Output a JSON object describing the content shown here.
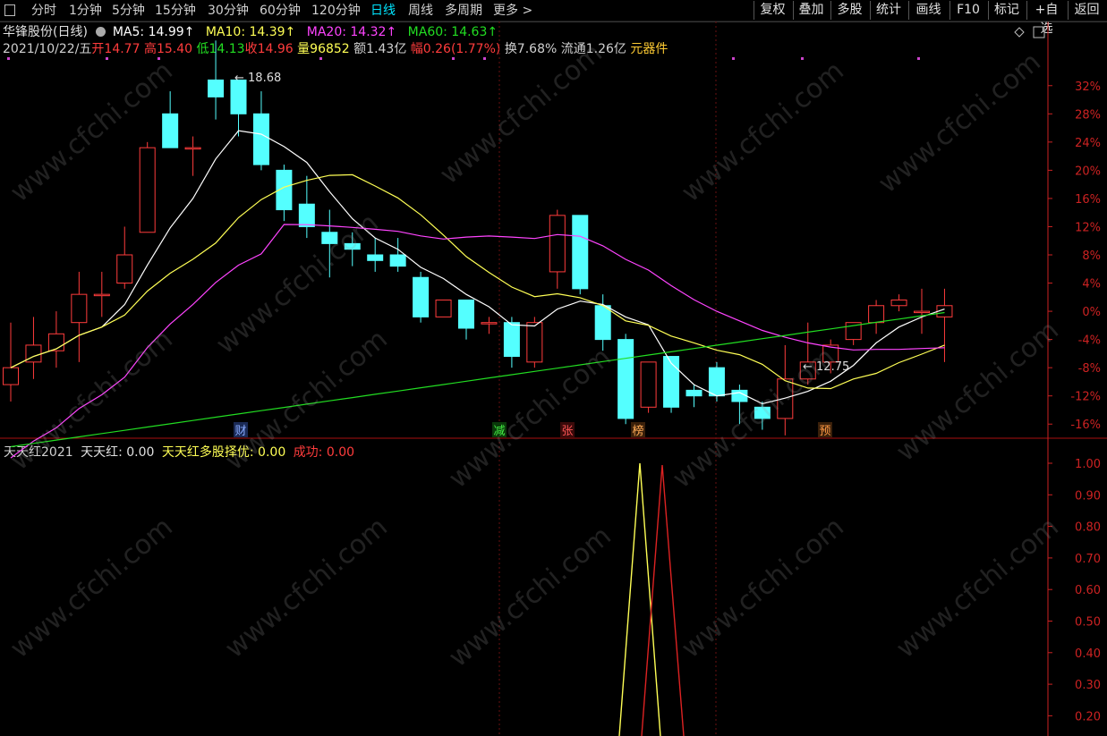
{
  "toolbar": {
    "periods": [
      "分时",
      "1分钟",
      "5分钟",
      "15分钟",
      "30分钟",
      "60分钟",
      "120分钟",
      "日线",
      "周线",
      "多周期",
      "更多 >"
    ],
    "active": "日线",
    "right_buttons": [
      "复权",
      "叠加",
      "多股",
      "统计",
      "画线",
      "F10",
      "标记",
      "+自选",
      "返回"
    ]
  },
  "stock": {
    "name": "华锋股份",
    "period": "(日线)",
    "ma5": "MA5: 14.99↑",
    "ma10": "MA10: 14.39↑",
    "ma20": "MA20: 14.32↑",
    "ma60": "MA60: 14.63↑",
    "date": "2021/10/22/五",
    "open": "开14.77",
    "high": "高15.40",
    "low": "低14.13",
    "close": "收14.96",
    "volume": "量96852",
    "amount": "额1.43亿",
    "change": "幅0.26(1.77%)",
    "turnover": "换7.68%",
    "float": "流通1.26亿",
    "sector": "元器件"
  },
  "indicator": {
    "name": "天天红2021",
    "v1": "天天红: 0.00",
    "v2": "天天红多股择优: 0.00",
    "v3": "成功: 0.00"
  },
  "colors": {
    "up": "#ff3c3c",
    "down": "#54ffff",
    "ma5": "#ffffff",
    "ma10": "#ffff55",
    "ma20": "#ff44ff",
    "ma60": "#22dd22",
    "axis": "#cc2222"
  },
  "watermark": "www.cfchi.com",
  "chart_data": {
    "type": "candlestick",
    "price_axis": {
      "labels": [
        "32%",
        "28%",
        "24%",
        "20%",
        "16%",
        "12%",
        "8%",
        "4%",
        "0%",
        "-4%",
        "-8%",
        "-12%",
        "-16%"
      ]
    },
    "candles": [
      {
        "o": 11.2,
        "c": 11.5,
        "h": 12.3,
        "l": 10.9
      },
      {
        "o": 11.6,
        "c": 11.9,
        "h": 12.4,
        "l": 11.3
      },
      {
        "o": 11.8,
        "c": 12.1,
        "h": 12.5,
        "l": 11.5
      },
      {
        "o": 12.3,
        "c": 12.8,
        "h": 13.2,
        "l": 11.6
      },
      {
        "o": 12.8,
        "c": 12.8,
        "h": 13.2,
        "l": 12.4
      },
      {
        "o": 13.0,
        "c": 13.5,
        "h": 14.0,
        "l": 12.9
      },
      {
        "o": 13.9,
        "c": 15.4,
        "h": 15.5,
        "l": 13.9
      },
      {
        "o": 16.0,
        "c": 15.4,
        "h": 16.4,
        "l": 15.4
      },
      {
        "o": 15.4,
        "c": 15.4,
        "h": 15.6,
        "l": 14.9
      },
      {
        "o": 16.6,
        "c": 16.3,
        "h": 17.3,
        "l": 15.9
      },
      {
        "o": 16.6,
        "c": 16.0,
        "h": 16.6,
        "l": 15.6
      },
      {
        "o": 16.0,
        "c": 15.1,
        "h": 16.4,
        "l": 15.0
      },
      {
        "o": 15.0,
        "c": 14.3,
        "h": 15.1,
        "l": 14.1
      },
      {
        "o": 14.4,
        "c": 14.0,
        "h": 14.9,
        "l": 13.8
      },
      {
        "o": 13.9,
        "c": 13.7,
        "h": 14.3,
        "l": 13.1
      },
      {
        "o": 13.7,
        "c": 13.6,
        "h": 13.9,
        "l": 13.3
      },
      {
        "o": 13.5,
        "c": 13.4,
        "h": 13.8,
        "l": 13.2
      },
      {
        "o": 13.5,
        "c": 13.3,
        "h": 13.8,
        "l": 13.2
      },
      {
        "o": 13.1,
        "c": 12.4,
        "h": 13.2,
        "l": 12.3
      },
      {
        "o": 12.4,
        "c": 12.7,
        "h": 12.7,
        "l": 12.4
      },
      {
        "o": 12.7,
        "c": 12.2,
        "h": 12.7,
        "l": 12.0
      },
      {
        "o": 12.3,
        "c": 12.3,
        "h": 12.4,
        "l": 12.1
      },
      {
        "o": 12.3,
        "c": 11.7,
        "h": 12.4,
        "l": 11.5
      },
      {
        "o": 11.6,
        "c": 12.3,
        "h": 12.4,
        "l": 11.5
      },
      {
        "o": 13.2,
        "c": 14.2,
        "h": 14.3,
        "l": 12.9
      },
      {
        "o": 14.2,
        "c": 12.9,
        "h": 14.2,
        "l": 12.8
      },
      {
        "o": 12.6,
        "c": 12.0,
        "h": 12.8,
        "l": 11.8
      },
      {
        "o": 12.0,
        "c": 10.6,
        "h": 12.1,
        "l": 10.5
      },
      {
        "o": 10.8,
        "c": 11.6,
        "h": 11.6,
        "l": 10.7
      },
      {
        "o": 11.7,
        "c": 10.8,
        "h": 11.7,
        "l": 10.7
      },
      {
        "o": 11.1,
        "c": 11.0,
        "h": 11.2,
        "l": 10.8
      },
      {
        "o": 11.5,
        "c": 11.0,
        "h": 11.6,
        "l": 10.9
      },
      {
        "o": 11.1,
        "c": 10.9,
        "h": 11.2,
        "l": 10.5
      },
      {
        "o": 10.8,
        "c": 10.6,
        "h": 10.9,
        "l": 10.4
      },
      {
        "o": 10.6,
        "c": 11.3,
        "h": 11.9,
        "l": 10.3
      },
      {
        "o": 11.3,
        "c": 11.6,
        "h": 12.3,
        "l": 11.2
      },
      {
        "o": 11.6,
        "c": 11.9,
        "h": 12.0,
        "l": 11.4
      },
      {
        "o": 12.0,
        "c": 12.3,
        "h": 12.3,
        "l": 11.9
      },
      {
        "o": 12.3,
        "c": 12.6,
        "h": 12.7,
        "l": 12.1
      },
      {
        "o": 12.6,
        "c": 12.7,
        "h": 12.8,
        "l": 12.5
      },
      {
        "o": 12.5,
        "c": 12.5,
        "h": 12.9,
        "l": 12.1
      },
      {
        "o": 12.4,
        "c": 12.6,
        "h": 12.9,
        "l": 11.6
      }
    ],
    "labels": {
      "high": "18.68",
      "low": "12.75"
    },
    "events": [
      "财",
      "减",
      "张",
      "榜",
      "预"
    ],
    "indicator_axis": [
      "1.00",
      "0.90",
      "0.80",
      "0.70",
      "0.60",
      "0.50",
      "0.40",
      "0.30",
      "0.20"
    ]
  }
}
